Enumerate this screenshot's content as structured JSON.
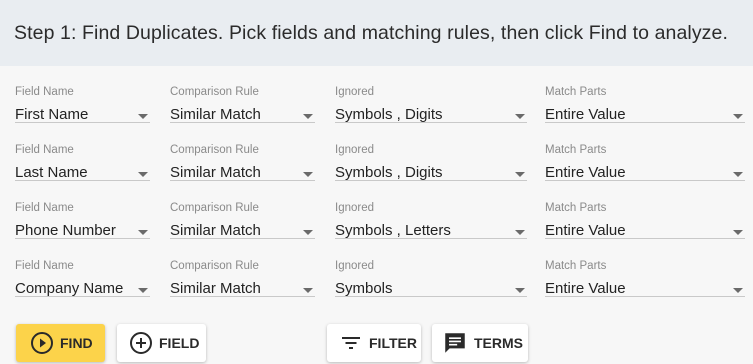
{
  "header": {
    "title": "Step 1: Find Duplicates. Pick fields and matching rules, then click Find to analyze."
  },
  "labels": {
    "field_name": "Field Name",
    "comparison_rule": "Comparison Rule",
    "ignored": "Ignored",
    "match_parts": "Match Parts"
  },
  "rows": [
    {
      "field": "First Name",
      "rule": "Similar Match",
      "ignored": "Symbols , Digits",
      "parts": "Entire Value"
    },
    {
      "field": "Last Name",
      "rule": "Similar Match",
      "ignored": "Symbols , Digits",
      "parts": "Entire Value"
    },
    {
      "field": "Phone Number",
      "rule": "Similar Match",
      "ignored": "Symbols , Letters",
      "parts": "Entire Value"
    },
    {
      "field": "Company Name",
      "rule": "Similar Match",
      "ignored": "Symbols",
      "parts": "Entire Value"
    }
  ],
  "buttons": {
    "find": {
      "label": "FIND",
      "icon": "play-circle-icon"
    },
    "field": {
      "label": "FIELD",
      "icon": "add-circle-icon"
    },
    "filter": {
      "label": "FILTER",
      "icon": "filter-list-icon"
    },
    "terms": {
      "label": "TERMS",
      "icon": "comment-box-icon"
    }
  },
  "colors": {
    "header_bg": "#e9edf1",
    "find_button": "#fcd34a"
  }
}
